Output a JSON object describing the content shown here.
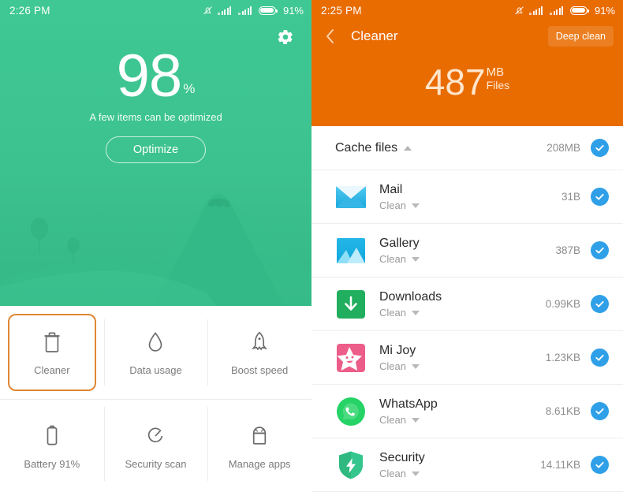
{
  "left": {
    "status": {
      "time": "2:26 PM",
      "battery_pct": "91%",
      "icons": [
        "bell-mute-icon",
        "signal-icon",
        "signal-icon",
        "battery-icon"
      ]
    },
    "settings_icon": "gear-icon",
    "score": {
      "value": "98",
      "unit": "%",
      "subtitle": "A few items can be optimized"
    },
    "optimize_label": "Optimize",
    "colors": {
      "hero_green": "#3fc894",
      "highlight_orange": "#df8733"
    },
    "tiles": [
      {
        "label": "Cleaner",
        "icon": "trash-icon",
        "selected": true
      },
      {
        "label": "Data usage",
        "icon": "droplet-icon",
        "selected": false
      },
      {
        "label": "Boost speed",
        "icon": "rocket-icon",
        "selected": false
      },
      {
        "label": "Battery 91%",
        "icon": "battery-icon",
        "selected": false
      },
      {
        "label": "Security scan",
        "icon": "clock-scan-icon",
        "selected": false
      },
      {
        "label": "Manage apps",
        "icon": "android-icon",
        "selected": false
      }
    ]
  },
  "right": {
    "status": {
      "time": "2:25 PM",
      "battery_pct": "91%",
      "icons": [
        "bell-mute-icon",
        "signal-icon",
        "signal-icon",
        "battery-icon"
      ]
    },
    "nav": {
      "back_icon": "back-chevron-icon",
      "title": "Cleaner",
      "action_label": "Deep clean"
    },
    "total": {
      "value": "487",
      "unit": "MB",
      "caption": "Files"
    },
    "colors": {
      "hero_orange": "#e96c00",
      "check_blue": "#2fa0e8"
    },
    "group": {
      "title": "Cache files",
      "size": "208MB",
      "expanded": true,
      "caret_icon": "caret-up-icon",
      "check_icon": "check-circle-icon"
    },
    "items": [
      {
        "name": "Mail",
        "status": "Clean",
        "size": "31B",
        "icon": "mail-icon",
        "checked": true
      },
      {
        "name": "Gallery",
        "status": "Clean",
        "size": "387B",
        "icon": "gallery-icon",
        "checked": true
      },
      {
        "name": "Downloads",
        "status": "Clean",
        "size": "0.99KB",
        "icon": "download-icon",
        "checked": true
      },
      {
        "name": "Mi Joy",
        "status": "Clean",
        "size": "1.23KB",
        "icon": "mi-joy-icon",
        "checked": true
      },
      {
        "name": "WhatsApp",
        "status": "Clean",
        "size": "8.61KB",
        "icon": "whatsapp-icon",
        "checked": true
      },
      {
        "name": "Security",
        "status": "Clean",
        "size": "14.11KB",
        "icon": "shield-bolt-icon",
        "checked": true
      }
    ]
  }
}
